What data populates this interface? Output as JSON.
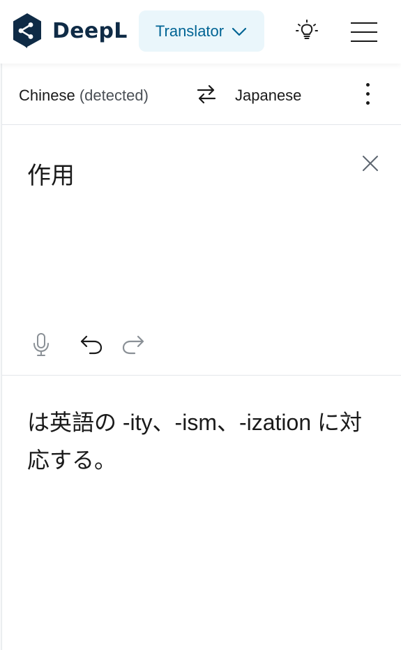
{
  "header": {
    "brand": "DeepL",
    "product_label": "Translator",
    "icons": {
      "logo": "deepl-logo-icon",
      "product_chevron": "chevron-down-icon",
      "tips": "lightbulb-icon",
      "menu": "hamburger-menu-icon"
    }
  },
  "languages": {
    "source_name": "Chinese",
    "source_suffix": "(detected)",
    "target_name": "Japanese",
    "icons": {
      "swap": "swap-arrows-icon",
      "more": "kebab-menu-icon"
    }
  },
  "source": {
    "text": "作用",
    "icons": {
      "clear": "close-icon",
      "mic": "microphone-icon",
      "undo": "undo-icon",
      "redo": "redo-icon"
    }
  },
  "target": {
    "text": "は英語の -ity、-ism、-ization に対応する。"
  },
  "colors": {
    "brand_navy": "#0f2b46",
    "accent_blue": "#006494",
    "accent_bg": "#eaf6fb",
    "divider": "#e3e6ea",
    "disabled_icon": "#8a9096"
  }
}
